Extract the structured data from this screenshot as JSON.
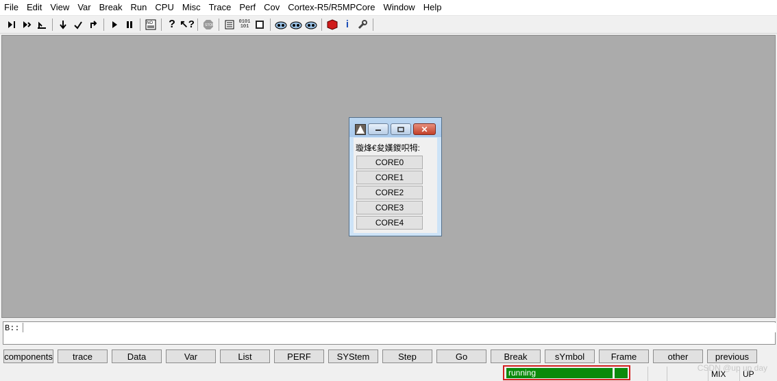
{
  "menubar": {
    "items": [
      "File",
      "Edit",
      "View",
      "Var",
      "Break",
      "Run",
      "CPU",
      "Misc",
      "Trace",
      "Perf",
      "Cov",
      "Cortex-R5/R5MPCore",
      "Window",
      "Help"
    ]
  },
  "toolbar": {
    "icons": [
      "step-into-icon",
      "step-over-icon",
      "return-icon",
      "step-down-icon",
      "check-step-icon",
      "back-step-icon",
      "go-icon",
      "break-icon",
      "nocpu-icon",
      "help-icon",
      "context-help-icon",
      "stop-icon",
      "list-icon",
      "memory-dump-icon",
      "register-icon",
      "view-1-icon",
      "view-2-icon",
      "view-3-icon",
      "cube-icon",
      "info-icon",
      "tools-icon"
    ]
  },
  "dialog": {
    "prompt": "璇烽€夋嫨鍐呮牳:",
    "close_glyph": "✕",
    "buttons": [
      "CORE0",
      "CORE1",
      "CORE2",
      "CORE3",
      "CORE4"
    ]
  },
  "command": {
    "prefix": "B::",
    "value": ""
  },
  "softkeys": [
    "components",
    "trace",
    "Data",
    "Var",
    "List",
    "PERF",
    "SYStem",
    "Step",
    "Go",
    "Break",
    "sYmbol",
    "Frame",
    "other",
    "previous"
  ],
  "status": {
    "state": "running",
    "mode": "MIX",
    "direction": "UP",
    "running_color": "#0b8a0b"
  },
  "watermark": "CSDN @up up day"
}
